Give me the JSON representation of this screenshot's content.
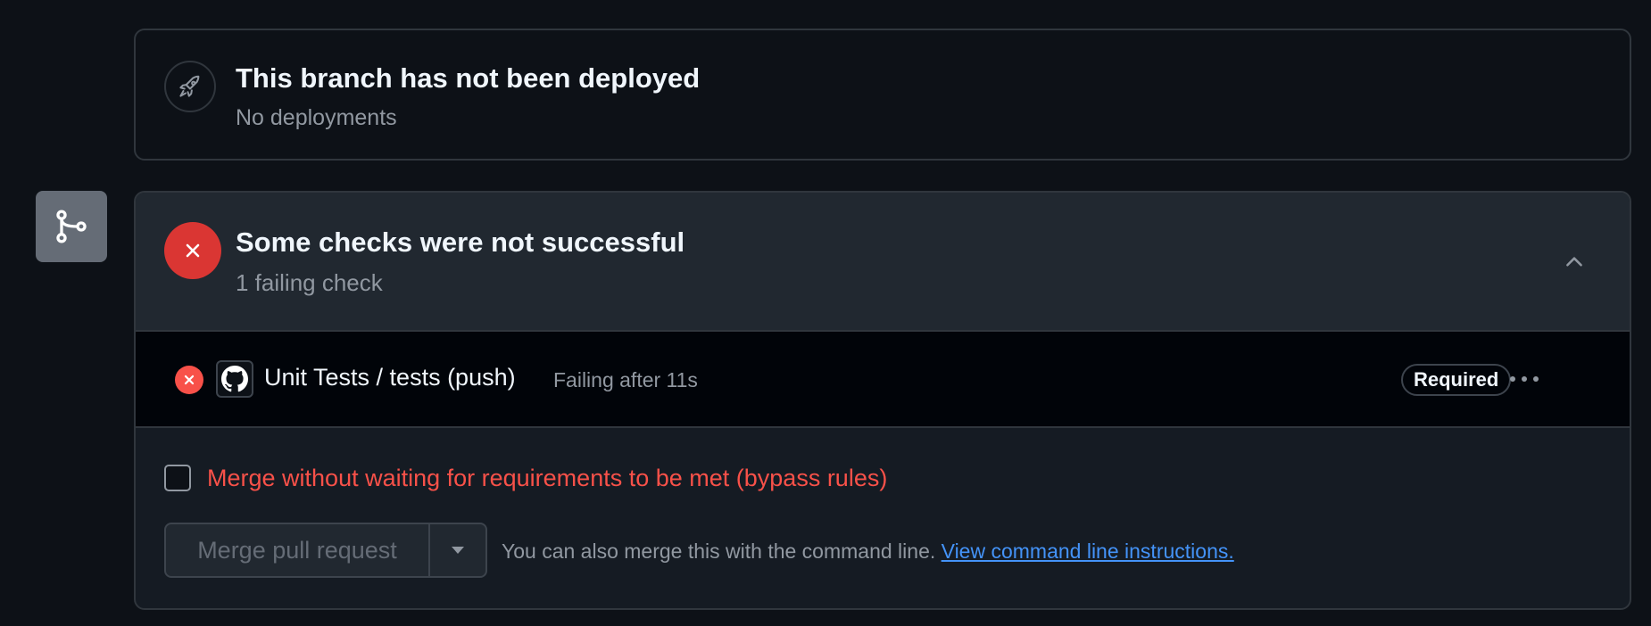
{
  "deployment": {
    "icon": "rocket-icon",
    "title": "This branch has not been deployed",
    "subtitle": "No deployments"
  },
  "merge_badge_icon": "git-merge-icon",
  "checks": {
    "status_icon": "x-circle-icon",
    "title": "Some checks were not successful",
    "subtitle": "1 failing check",
    "toggle_icon": "chevron-up-icon",
    "items": [
      {
        "status_icon": "x-circle-icon",
        "app_icon": "github-icon",
        "name": "Unit Tests / tests (push)",
        "status": "Failing after 11s",
        "badge": "Required",
        "menu_icon": "kebab-horizontal-icon"
      }
    ]
  },
  "bypass": {
    "checked": false,
    "label": "Merge without waiting for requirements to be met (bypass rules)"
  },
  "merge": {
    "button_label": "Merge pull request",
    "caret_icon": "triangle-down-icon",
    "helper_text": "You can also merge this with the command line.",
    "link_text": "View command line instructions."
  },
  "colors": {
    "background": "#0d1117",
    "border": "#30363d",
    "danger": "#da3633",
    "danger_text": "#f85149",
    "link": "#4493f8",
    "muted": "#9198a1"
  }
}
